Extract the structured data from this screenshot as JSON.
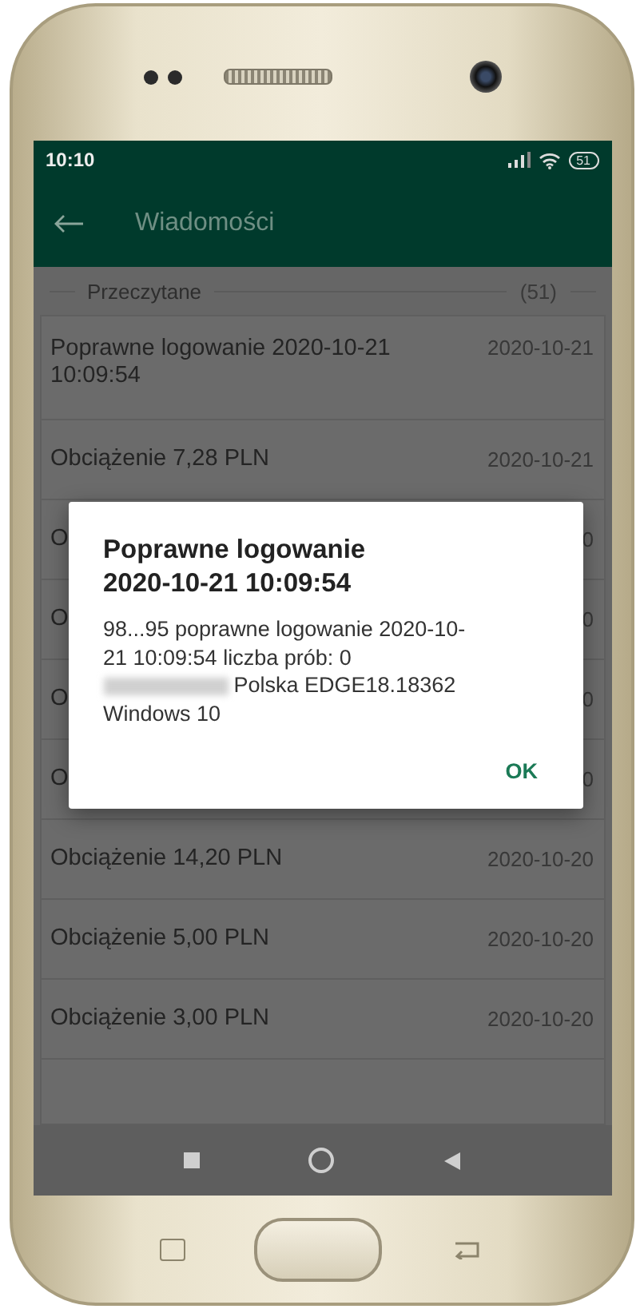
{
  "status_bar": {
    "time": "10:10",
    "battery": "51"
  },
  "app_bar": {
    "title": "Wiadomości"
  },
  "section": {
    "label": "Przeczytane",
    "count": "(51)"
  },
  "messages": [
    {
      "title": "Poprawne logowanie 2020-10-21 10:09:54",
      "date": "2020-10-21"
    },
    {
      "title": "Obciążenie 7,28 PLN",
      "date": "2020-10-21"
    },
    {
      "title": "O",
      "date": "0"
    },
    {
      "title": "O",
      "date": "0"
    },
    {
      "title": "O",
      "date": "0"
    },
    {
      "title": "O",
      "date": "0"
    },
    {
      "title": "Obciążenie 14,20 PLN",
      "date": "2020-10-20"
    },
    {
      "title": "Obciążenie 5,00 PLN",
      "date": "2020-10-20"
    },
    {
      "title": "Obciążenie 3,00 PLN",
      "date": "2020-10-20"
    }
  ],
  "dialog": {
    "title": "Poprawne logowanie 2020-10-21 10:09:54",
    "body_before": "98...95 poprawne logowanie 2020-10-21 10:09:54 liczba prób: 0",
    "body_after": "Polska EDGE18.18362 Windows 10",
    "button": "OK"
  }
}
